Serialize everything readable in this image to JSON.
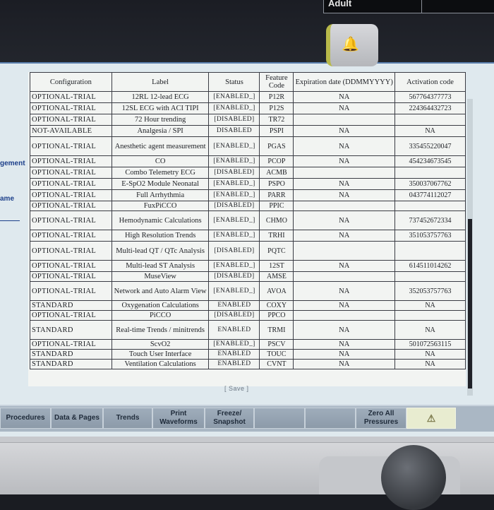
{
  "top_status": {
    "patient_category": "Adult"
  },
  "side_panel": {
    "label_1": "gement",
    "label_2": "ame"
  },
  "table": {
    "headers": {
      "configuration": "Configuration",
      "label": "Label",
      "status": "Status",
      "feature_code": "Feature Code",
      "expiration_date": "Expiration date (DDMMYYYY)",
      "activation_code": "Activation code"
    },
    "rows": [
      {
        "configuration": "OPTIONAL-TRIAL",
        "label": "12RL 12-lead ECG",
        "status": "[ENABLED_]",
        "code": "P12R",
        "expiration": "NA",
        "activation": "567764377773"
      },
      {
        "configuration": "OPTIONAL-TRIAL",
        "label": "12SL ECG with ACI TIPI",
        "status": "[ENABLED_]",
        "code": "P12S",
        "expiration": "NA",
        "activation": "224364432723"
      },
      {
        "configuration": "OPTIONAL-TRIAL",
        "label": "72 Hour trending",
        "status": "[DISABLED]",
        "code": "TR72",
        "expiration": "",
        "activation": ""
      },
      {
        "configuration": "NOT-AVAILABLE",
        "label": "Analgesia / SPI",
        "status": "DISABLED",
        "code": "PSPI",
        "expiration": "NA",
        "activation": "NA"
      },
      {
        "configuration": "OPTIONAL-TRIAL",
        "label": "Anesthetic agent measurement",
        "status": "[ENABLED_]",
        "code": "PGAS",
        "expiration": "NA",
        "activation": "335455220047"
      },
      {
        "configuration": "OPTIONAL-TRIAL",
        "label": "CO",
        "status": "[ENABLED_]",
        "code": "PCOP",
        "expiration": "NA",
        "activation": "454234673545"
      },
      {
        "configuration": "OPTIONAL-TRIAL",
        "label": "Combo Telemetry ECG",
        "status": "[DISABLED]",
        "code": "ACMB",
        "expiration": "",
        "activation": ""
      },
      {
        "configuration": "OPTIONAL-TRIAL",
        "label": "E-SpO2 Module Neonatal",
        "status": "[ENABLED_]",
        "code": "PSPO",
        "expiration": "NA",
        "activation": "350037067762"
      },
      {
        "configuration": "OPTIONAL-TRIAL",
        "label": "Full Arrhythmia",
        "status": "[ENABLED_]",
        "code": "PARR",
        "expiration": "NA",
        "activation": "043774112027"
      },
      {
        "configuration": "OPTIONAL-TRIAL",
        "label": "FuxPiCCO",
        "status": "[DISABLED]",
        "code": "PPIC",
        "expiration": "",
        "activation": ""
      },
      {
        "configuration": "OPTIONAL-TRIAL",
        "label": "Hemodynamic Calculations",
        "status": "[ENABLED_]",
        "code": "CHMO",
        "expiration": "NA",
        "activation": "737452672334"
      },
      {
        "configuration": "OPTIONAL-TRIAL",
        "label": "High Resolution Trends",
        "status": "[ENABLED_]",
        "code": "TRHI",
        "expiration": "NA",
        "activation": "351053757763"
      },
      {
        "configuration": "OPTIONAL-TRIAL",
        "label": "Multi-lead QT / QTc Analysis",
        "status": "[DISABLED]",
        "code": "PQTC",
        "expiration": "",
        "activation": ""
      },
      {
        "configuration": "OPTIONAL-TRIAL",
        "label": "Multi-lead ST Analysis",
        "status": "[ENABLED_]",
        "code": "12ST",
        "expiration": "NA",
        "activation": "614511014262"
      },
      {
        "configuration": "OPTIONAL-TRIAL",
        "label": "MuseView",
        "status": "[DISABLED]",
        "code": "AMSE",
        "expiration": "",
        "activation": ""
      },
      {
        "configuration": "OPTIONAL-TRIAL",
        "label": "Network and Auto Alarm View",
        "status": "[ENABLED_]",
        "code": "AVOA",
        "expiration": "NA",
        "activation": "352053757763"
      },
      {
        "configuration": "STANDARD",
        "label": "Oxygenation Calculations",
        "status": "ENABLED",
        "code": "COXY",
        "expiration": "NA",
        "activation": "NA"
      },
      {
        "configuration": "OPTIONAL-TRIAL",
        "label": "PiCCO",
        "status": "[DISABLED]",
        "code": "PPCO",
        "expiration": "",
        "activation": ""
      },
      {
        "configuration": "STANDARD",
        "label": "Real-time Trends / minitrends",
        "status": "ENABLED",
        "code": "TRMI",
        "expiration": "NA",
        "activation": "NA"
      },
      {
        "configuration": "OPTIONAL-TRIAL",
        "label": "ScvO2",
        "status": "[ENABLED_]",
        "code": "PSCV",
        "expiration": "NA",
        "activation": "501072563115"
      },
      {
        "configuration": "STANDARD",
        "label": "Touch User Interface",
        "status": "ENABLED",
        "code": "TOUC",
        "expiration": "NA",
        "activation": "NA"
      },
      {
        "configuration": "STANDARD",
        "label": "Ventilation Calculations",
        "status": "ENABLED",
        "code": "CVNT",
        "expiration": "NA",
        "activation": "NA"
      }
    ],
    "row_heights": [
      16,
      16,
      16,
      16,
      27,
      16,
      16,
      16,
      16,
      14,
      27,
      16,
      27,
      16,
      14,
      27,
      14,
      14,
      27,
      14,
      14,
      14
    ]
  },
  "save_label": "[ Save ]",
  "toolbar": {
    "buttons": [
      {
        "label": "Procedures",
        "icon": ""
      },
      {
        "label": "Data & Pages",
        "icon": ""
      },
      {
        "label": "Trends",
        "icon": ""
      },
      {
        "label": "Print Waveforms",
        "icon": ""
      },
      {
        "label": "Freeze/ Snapshot",
        "icon": ""
      },
      {
        "label": "",
        "icon": ""
      },
      {
        "label": "",
        "icon": ""
      },
      {
        "label": "Zero All Pressures",
        "icon": ""
      },
      {
        "label": "",
        "icon": "warning-bell-icon"
      }
    ]
  }
}
